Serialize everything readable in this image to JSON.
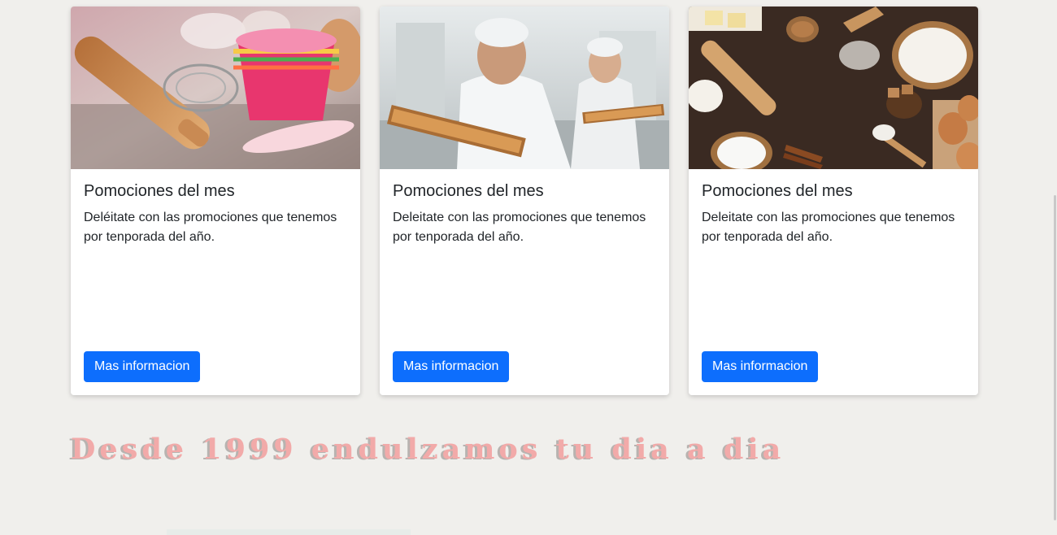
{
  "cards": [
    {
      "image_alt": "baking-tools-cupcake-liners",
      "title": "Pomociones del mes",
      "text": "Deléitate con las promociones que tenemos por tenporada del año.",
      "button_label": "Mas informacion"
    },
    {
      "image_alt": "bakers-with-trays",
      "title": "Pomociones del mes",
      "text": "Deleitate con las promociones que tenemos por tenporada del año.",
      "button_label": "Mas informacion"
    },
    {
      "image_alt": "baking-ingredients-flatlay",
      "title": "Pomociones del mes",
      "text": "Deleitate con las promociones que tenemos por tenporada del año.",
      "button_label": "Mas informacion"
    }
  ],
  "tagline": "Desde 1999 endulzamos tu dia a dia",
  "colors": {
    "button": "#0d6efd",
    "tagline": "#f2aaa9",
    "background": "#f0efec"
  }
}
